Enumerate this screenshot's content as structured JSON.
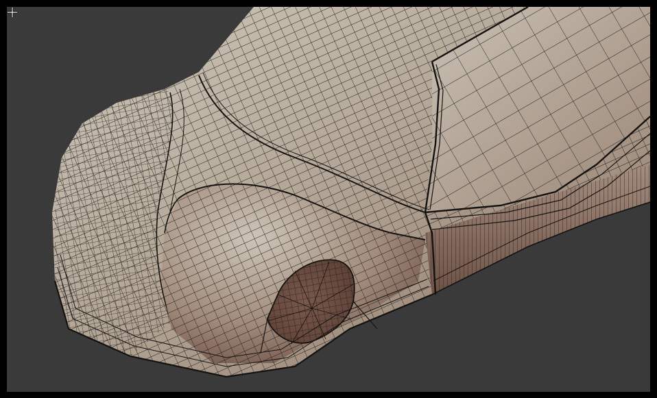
{
  "viewport": {
    "background": "#3a3a3a",
    "frame_color": "#000000",
    "model": "car-body-mesh",
    "shading": "wireframe-on-shaded",
    "surface_colors": {
      "light": "#c5bdb0",
      "mid": "#a3907f",
      "dark": "#6f5448",
      "wire": "#1c1a18"
    }
  },
  "cursor": {
    "icon": "crosshair-cursor-icon"
  }
}
